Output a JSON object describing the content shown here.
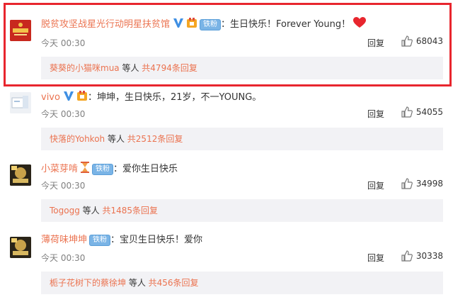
{
  "comments": [
    {
      "username": "脱贫攻坚战星光行动明星扶贫馆",
      "fan_badge": "铁粉",
      "text": "：生日快乐！Forever Young！",
      "time": "今天 00:30",
      "reply_label": "回复",
      "likes": "68043",
      "thread_user": "葵葵的小猫咪mua",
      "thread_mid": " 等人 ",
      "thread_count": "共4794条回复",
      "avatar_color": "#c8281e"
    },
    {
      "username": "vivo",
      "text": "：坤坤，生日快乐，21岁，不一YOUNG。",
      "time": "今天 00:30",
      "reply_label": "回复",
      "likes": "54055",
      "thread_user": "快落的Yohkoh",
      "thread_mid": " 等人 ",
      "thread_count": "共2512条回复",
      "avatar_color": "#e9edf2"
    },
    {
      "username": "小菜芽啃",
      "fan_badge": "铁粉",
      "text": "：爱你生日快乐",
      "time": "今天 00:30",
      "reply_label": "回复",
      "likes": "34998",
      "thread_user": "Togogg",
      "thread_mid": " 等人 ",
      "thread_count": "共1485条回复",
      "avatar_color": "#2a2418"
    },
    {
      "username": "薄荷味坤坤",
      "fan_badge": "铁粉",
      "text": "：宝贝生日快乐！爱你",
      "time": "今天 00:30",
      "reply_label": "回复",
      "likes": "30338",
      "thread_user": "栀子花树下的蔡徐坤",
      "thread_mid": " 等人 ",
      "thread_count": "共456条回复",
      "avatar_color": "#2a2418"
    }
  ],
  "colors": {
    "username": "#eb7350",
    "highlight_border": "#e8262e",
    "reply_box_bg": "#f2f2f5"
  }
}
